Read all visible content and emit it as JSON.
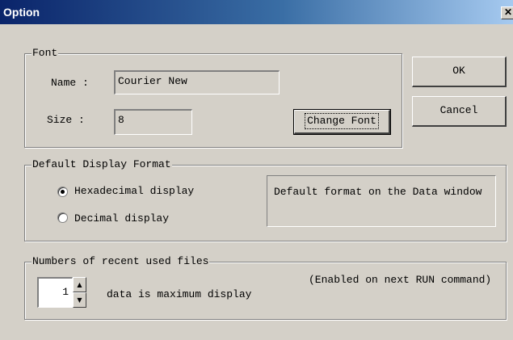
{
  "window": {
    "title": "Option",
    "close_glyph": "✕"
  },
  "font_group": {
    "legend": "Font",
    "name_label": "Name :",
    "name_value": "Courier New",
    "size_label": "Size :",
    "size_value": "8",
    "change_font_label": "Change Font"
  },
  "buttons": {
    "ok_label": "OK",
    "cancel_label": "Cancel"
  },
  "display_format": {
    "legend": "Default Display Format",
    "options": [
      {
        "label": "Hexadecimal display",
        "selected": true
      },
      {
        "label": "Decimal display",
        "selected": false
      }
    ],
    "description": "Default format on the Data window"
  },
  "recent_files": {
    "legend": "Numbers of recent used files",
    "count_value": "1",
    "suffix_label": "data is maximum display",
    "note": "(Enabled on next RUN command)",
    "spin_up_glyph": "▲",
    "spin_down_glyph": "▼"
  }
}
